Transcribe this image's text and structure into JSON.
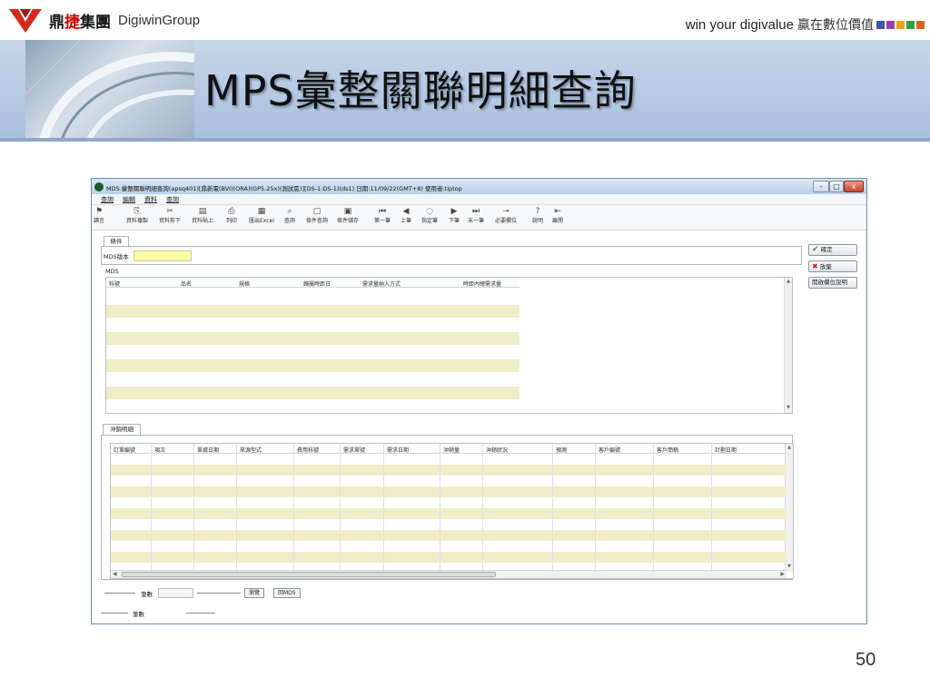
{
  "brand": {
    "logo_cn_prefix": "鼎",
    "logo_cn_red": "捷",
    "logo_cn_suffix": "集團",
    "logo_en": "DigiwinGroup",
    "slogan_en": "win your digivalue",
    "slogan_cn": "贏在數位價值",
    "square_colors": [
      "#3a57a8",
      "#9b3fb0",
      "#e6a51c",
      "#2ea24a",
      "#e0601c",
      "#3a57a8"
    ]
  },
  "slide": {
    "title": "MPS彙整關聯明細查詢",
    "page_number": "50"
  },
  "window": {
    "title": "MDS 彙整關聯明細查詢(apsq401)[鼎新電(BVI)(ORA)(GP5.25x)(測試區)][DS-1:DS-1)(ds1)  日期:11/09/22(GMT+8)  使用者:tiptop",
    "buttons": {
      "minimize": "–",
      "maximize": "□",
      "close": "x"
    },
    "menu": [
      "查詢",
      "編輯",
      "資料",
      "查詢"
    ],
    "toolbar": [
      {
        "icon": "flag-icon",
        "glyph": "⚑",
        "label": "讀言"
      },
      {
        "icon": "copy-icon",
        "glyph": "⎘",
        "label": "資料複製"
      },
      {
        "icon": "cut-icon",
        "glyph": "✂",
        "label": "資料剪下"
      },
      {
        "icon": "paste-icon",
        "glyph": "▤",
        "label": "資料貼上"
      },
      {
        "icon": "print-icon",
        "glyph": "⎙",
        "label": "列印"
      },
      {
        "icon": "excel-icon",
        "glyph": "▦",
        "label": "匯出Excel"
      },
      {
        "icon": "binoculars-icon",
        "glyph": "⌕",
        "label": "查詢"
      },
      {
        "icon": "doc-query-icon",
        "glyph": "▢",
        "label": "條件查詢"
      },
      {
        "icon": "doc-save-icon",
        "glyph": "▣",
        "label": "條件儲存"
      },
      {
        "icon": "first-icon",
        "glyph": "⏮",
        "label": "第一筆"
      },
      {
        "icon": "prev-icon",
        "glyph": "◀",
        "label": "上筆"
      },
      {
        "icon": "goto-icon",
        "glyph": "◌",
        "label": "指定筆"
      },
      {
        "icon": "next-icon",
        "glyph": "▶",
        "label": "下筆"
      },
      {
        "icon": "last-icon",
        "glyph": "⏭",
        "label": "末一筆"
      },
      {
        "icon": "key-icon",
        "glyph": "⊸",
        "label": "必要欄位"
      },
      {
        "icon": "help-icon",
        "glyph": "?",
        "label": "說明"
      },
      {
        "icon": "exit-icon",
        "glyph": "⇤",
        "label": "離開"
      }
    ],
    "condition_tab": "條件",
    "condition_label": "MDS版本",
    "condition_value": "",
    "mds_label": "MDS",
    "grid1_columns": [
      "料號",
      "品名",
      "規格",
      "歸屬時距日",
      "需求量納入方式",
      "時距內總需求量"
    ],
    "detail_tab": "沖銷明細",
    "grid2_columns": [
      "訂單編號",
      "項次",
      "單據日期",
      "來源型式",
      "費用科號",
      "需求單號",
      "需求日期",
      "沖銷量",
      "沖銷狀況",
      "預測",
      "客戶編號",
      "客戶簡稱",
      "計劃日期"
    ],
    "side_buttons": {
      "ok": "確定",
      "cancel": "放棄",
      "help": "開啟欄位說明"
    },
    "footer": {
      "count_label": "筆數",
      "count_value": "",
      "browse_button": "瀏覽",
      "back_button": "回MDS",
      "bottom_count_label": "筆數"
    }
  }
}
